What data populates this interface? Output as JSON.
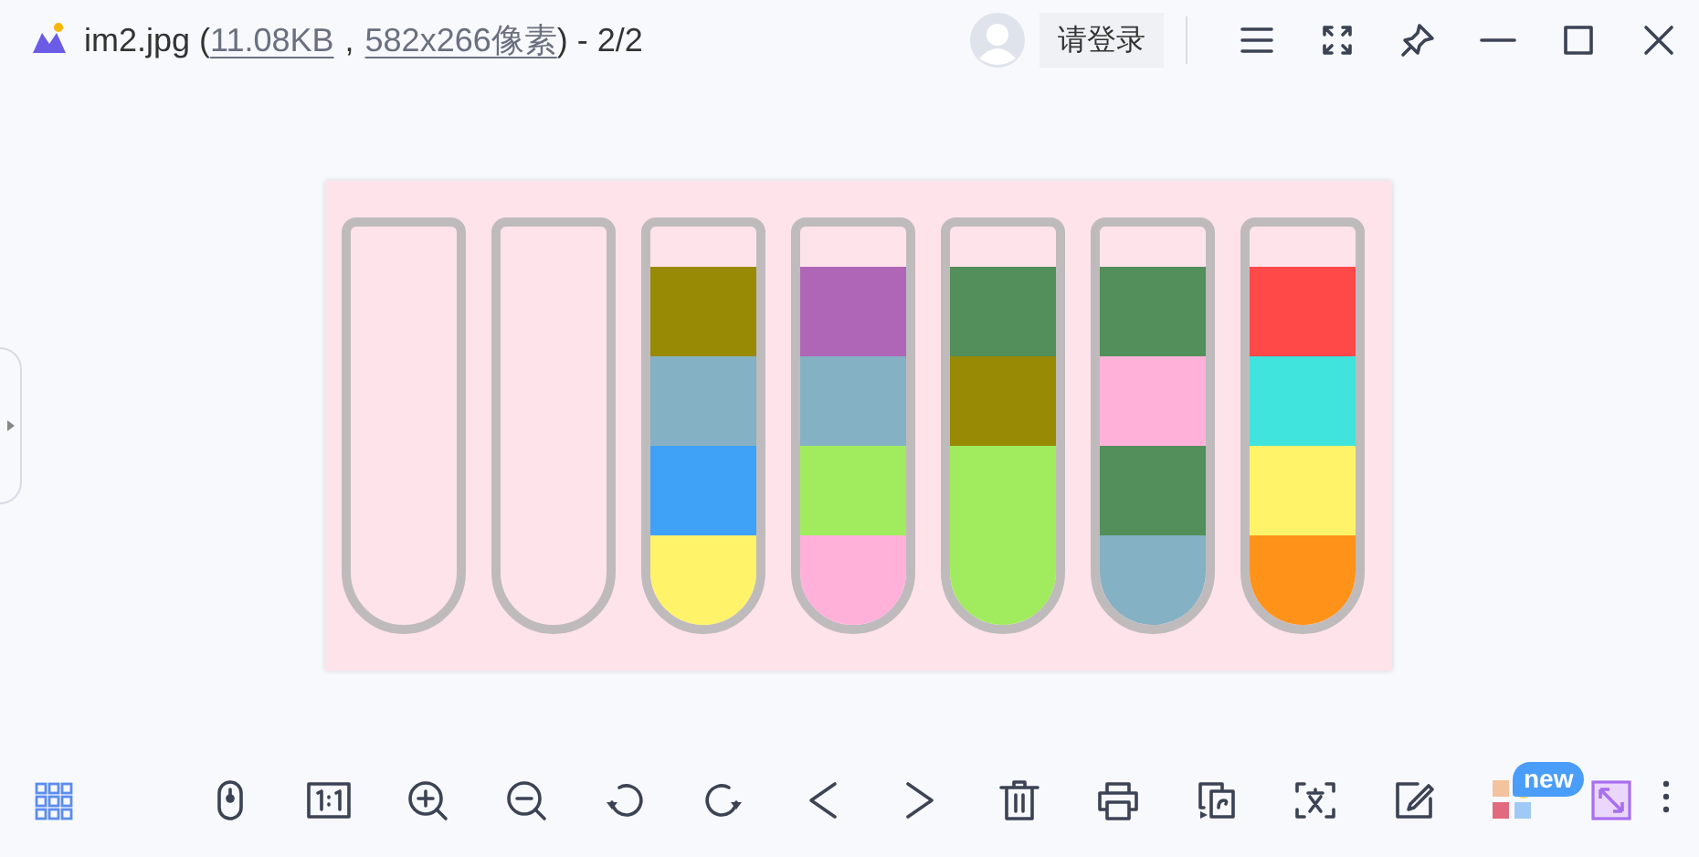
{
  "title": {
    "name": "im2.jpg (",
    "size": "11.08KB",
    "separator": ",",
    "dimensions": "582x266像素",
    "tail": ") - 2/2"
  },
  "account": {
    "login": "请登录"
  },
  "image": {
    "tubes": [
      {
        "kind": "empty"
      },
      {
        "kind": "empty"
      },
      {
        "kind": "filled",
        "segments": [
          {
            "color": "#998a06"
          },
          {
            "color": "#84b1c3"
          },
          {
            "color": "#3fa2f6"
          },
          {
            "color": "#fff36a"
          }
        ]
      },
      {
        "kind": "filled",
        "segments": [
          {
            "color": "#b066b7"
          },
          {
            "color": "#84b1c3"
          },
          {
            "color": "#a0ec5e"
          },
          {
            "color": "#ffb1da"
          }
        ]
      },
      {
        "kind": "filled",
        "segments": [
          {
            "color": "#528f5a"
          },
          {
            "color": "#998a06"
          },
          {
            "color": "#a0ec5e"
          },
          {
            "color": "#a0ec5e"
          }
        ]
      },
      {
        "kind": "filled",
        "segments": [
          {
            "color": "#528f5a"
          },
          {
            "color": "#ffb1da"
          },
          {
            "color": "#528f5a"
          },
          {
            "color": "#84b1c3"
          }
        ]
      },
      {
        "kind": "filled",
        "segments": [
          {
            "color": "#ff4848"
          },
          {
            "color": "#40e4dc"
          },
          {
            "color": "#fff36a"
          },
          {
            "color": "#ff9218"
          }
        ]
      }
    ]
  },
  "toolbar": {
    "badge": "new"
  }
}
